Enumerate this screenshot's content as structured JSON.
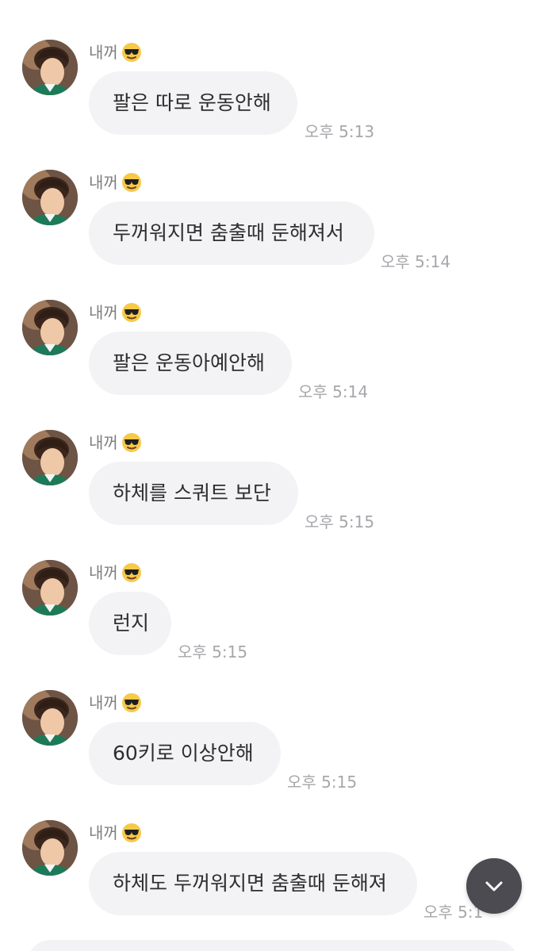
{
  "chat": {
    "messages": [
      {
        "sender": "내꺼",
        "text": "팔은 따로 운동안해",
        "time": "오후 5:13"
      },
      {
        "sender": "내꺼",
        "text": "두꺼워지면 춤출때 둔해져서",
        "time": "오후 5:14"
      },
      {
        "sender": "내꺼",
        "text": "팔은 운동아예안해",
        "time": "오후 5:14"
      },
      {
        "sender": "내꺼",
        "text": "하체를 스쿼트 보단",
        "time": "오후 5:15"
      },
      {
        "sender": "내꺼",
        "text": "런지",
        "time": "오후 5:15"
      },
      {
        "sender": "내꺼",
        "text": "60키로 이상안해",
        "time": "오후 5:15"
      },
      {
        "sender": "내꺼",
        "text": "하체도 두꺼워지면 춤출때 둔해져",
        "time": "오후 5:1"
      }
    ]
  },
  "icons": {
    "avatar": "profile-photo",
    "emoji": "sunglasses-emoji-icon",
    "scroll_button": "chevron-down-icon"
  },
  "colors": {
    "bubble_background": "#f3f3f5",
    "timestamp": "#a7a7ab",
    "sender_name": "#7d7d7d",
    "scroll_button": "#4b4b51"
  }
}
